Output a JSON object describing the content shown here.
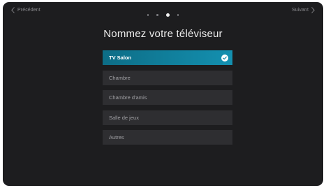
{
  "nav": {
    "previous_label": "Précédent",
    "next_label": "Suivant"
  },
  "progress": {
    "total_steps": 4,
    "current_step": 3
  },
  "title": "Nommez votre téléviseur",
  "options": [
    {
      "label": "TV Salon",
      "selected": true
    },
    {
      "label": "Chambre",
      "selected": false
    },
    {
      "label": "Chambre d'amis",
      "selected": false
    },
    {
      "label": "Salle de jeux",
      "selected": false
    },
    {
      "label": "Autres",
      "selected": false
    }
  ],
  "icons": {
    "previous": "chevron-left-icon",
    "next": "chevron-right-icon",
    "selected": "checkmark-circle-icon"
  },
  "colors": {
    "background": "#1d1d1f",
    "selected_start": "#0d6d86",
    "selected_end": "#1490b0",
    "item_background": "#2e2e31"
  }
}
